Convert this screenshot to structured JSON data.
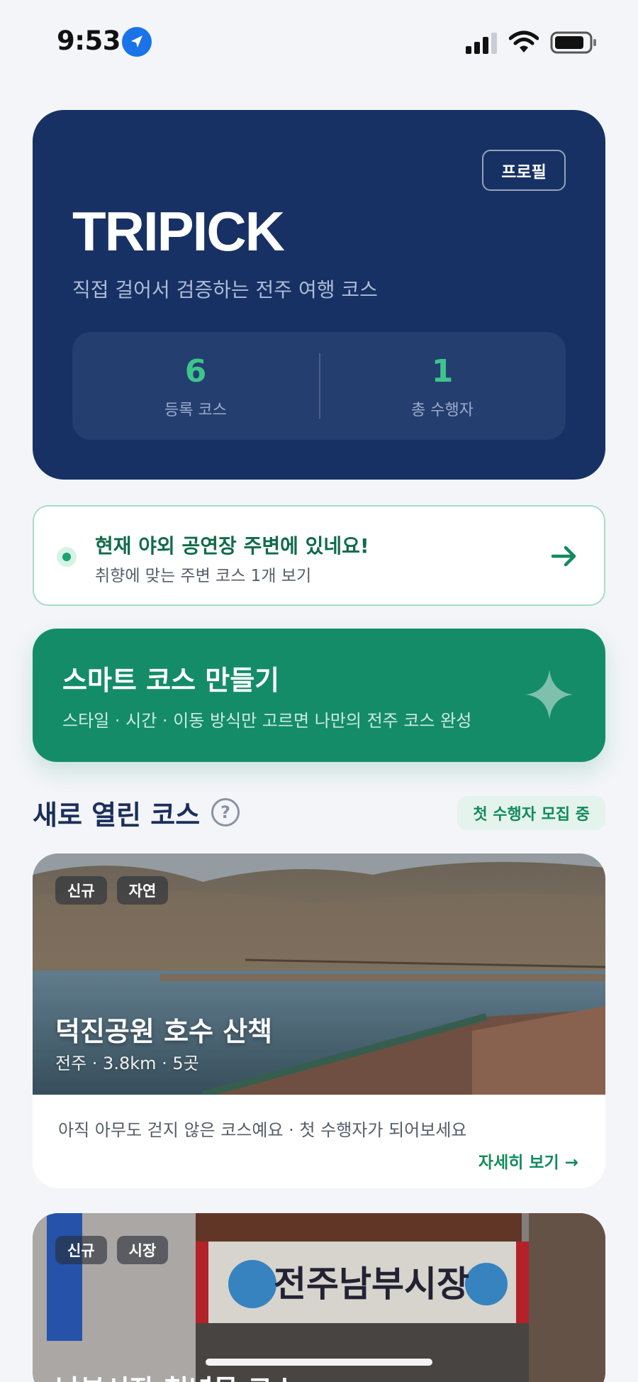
{
  "status_bar": {
    "time": "9:53",
    "icons": [
      "location-arrow-icon",
      "signal-icon",
      "wifi-icon",
      "battery-icon"
    ]
  },
  "hero": {
    "profile_label": "프로필",
    "brand": "TRIPICK",
    "subtitle": "직접 걸어서 검증하는 전주 여행 코스",
    "stats": [
      {
        "value": "6",
        "label": "등록 코스"
      },
      {
        "value": "1",
        "label": "총 수행자"
      }
    ]
  },
  "location_banner": {
    "title": "현재 야외 공연장 주변에 있네요!",
    "subtitle": "취향에 맞는 주변 코스 1개 보기"
  },
  "smart_course": {
    "title": "스마트 코스 만들기",
    "subtitle": "스타일 · 시간 · 이동 방식만 고르면 나만의 전주 코스 완성"
  },
  "new_courses": {
    "title": "새로 열린 코스",
    "help": "?",
    "badge": "첫 수행자 모집 중"
  },
  "courses": [
    {
      "tags": [
        "신규",
        "자연"
      ],
      "name": "덕진공원 호수 산책",
      "meta": "전주 · 3.8km · 5곳",
      "description": "아직 아무도 걷지 않은 코스예요 · 첫 수행자가 되어보세요",
      "link": "자세히 보기 →"
    },
    {
      "tags": [
        "신규",
        "시장"
      ],
      "name": "남부시장 청년몰 코스",
      "sign_text": "전주남부시장"
    }
  ],
  "colors": {
    "navy": "#173164",
    "green": "#158c68",
    "accent_green": "#3ec48d"
  }
}
